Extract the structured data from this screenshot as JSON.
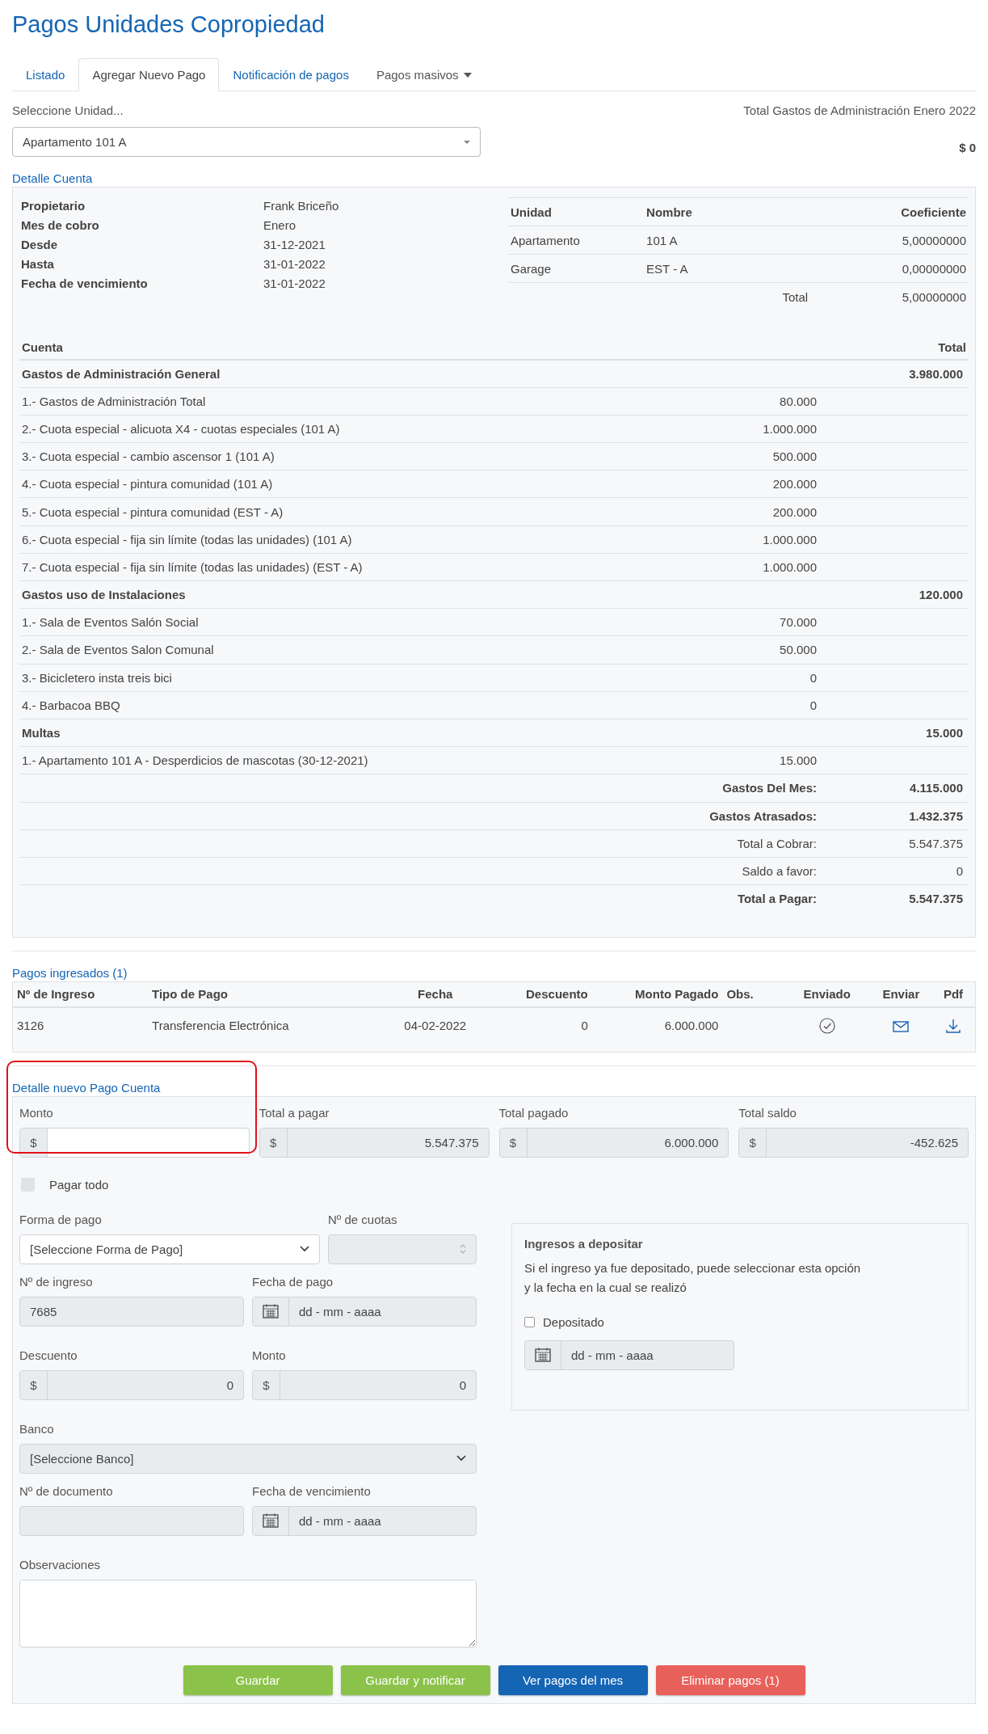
{
  "title": "Pagos Unidades Copropiedad",
  "tabs": [
    {
      "label": "Listado",
      "kind": "link",
      "selected": false
    },
    {
      "label": "Agregar Nuevo Pago",
      "kind": "link",
      "selected": true
    },
    {
      "label": "Notificación de pagos",
      "kind": "link",
      "selected": false
    },
    {
      "label": "Pagos masivos",
      "kind": "dropdown",
      "selected": false
    }
  ],
  "unit_select": {
    "label": "Seleccione Unidad...",
    "value": "Apartamento 101 A"
  },
  "admin_total": {
    "label": "Total Gastos de Administración Enero 2022",
    "value": "$ 0"
  },
  "account_detail": {
    "heading": "Detalle Cuenta",
    "info": [
      {
        "label": "Propietario",
        "value": "Frank Briceño"
      },
      {
        "label": "Mes de cobro",
        "value": "Enero"
      },
      {
        "label": "Desde",
        "value": "31-12-2021"
      },
      {
        "label": "Hasta",
        "value": "31-01-2022"
      },
      {
        "label": "Fecha de vencimiento",
        "value": "31-01-2022"
      }
    ],
    "units_table": {
      "columns": [
        "Unidad",
        "Nombre",
        "Coeficiente"
      ],
      "rows": [
        [
          "Apartamento",
          "101 A",
          "5,00000000"
        ],
        [
          "Garage",
          "EST - A",
          "0,00000000"
        ]
      ],
      "total_label": "Total",
      "total_value": "5,00000000"
    },
    "accounts": {
      "columns": [
        "Cuenta",
        "Total"
      ],
      "rows": [
        {
          "kind": "group",
          "label": "Gastos de Administración General",
          "total": "3.980.000"
        },
        {
          "kind": "item",
          "label": "1.- Gastos de Administración Total",
          "amount": "80.000"
        },
        {
          "kind": "item",
          "label": "2.- Cuota especial - alicuota X4 - cuotas especiales (101 A)",
          "amount": "1.000.000"
        },
        {
          "kind": "item",
          "label": "3.- Cuota especial - cambio ascensor 1 (101 A)",
          "amount": "500.000"
        },
        {
          "kind": "item",
          "label": "4.- Cuota especial - pintura comunidad (101 A)",
          "amount": "200.000"
        },
        {
          "kind": "item",
          "label": "5.- Cuota especial - pintura comunidad (EST - A)",
          "amount": "200.000"
        },
        {
          "kind": "item",
          "label": "6.- Cuota especial - fija sin límite (todas las unidades) (101 A)",
          "amount": "1.000.000"
        },
        {
          "kind": "item",
          "label": "7.- Cuota especial - fija sin límite (todas las unidades) (EST - A)",
          "amount": "1.000.000"
        },
        {
          "kind": "group",
          "label": "Gastos uso de Instalaciones",
          "total": "120.000"
        },
        {
          "kind": "item",
          "label": "1.- Sala de Eventos Salón Social",
          "amount": "70.000"
        },
        {
          "kind": "item",
          "label": "2.- Sala de Eventos Salon Comunal",
          "amount": "50.000"
        },
        {
          "kind": "item",
          "label": "3.- Bicicletero insta treis bici",
          "amount": "0"
        },
        {
          "kind": "item",
          "label": "4.- Barbacoa BBQ",
          "amount": "0"
        },
        {
          "kind": "group",
          "label": "Multas",
          "total": "15.000"
        },
        {
          "kind": "item",
          "label": "1.- Apartamento 101 A - Desperdicios de mascotas (30-12-2021)",
          "amount": "15.000"
        },
        {
          "kind": "summary",
          "label": "Gastos Del Mes:",
          "total": "4.115.000",
          "bold": true
        },
        {
          "kind": "summary",
          "label": "Gastos Atrasados:",
          "total": "1.432.375",
          "bold": true
        },
        {
          "kind": "summary",
          "label": "Total a Cobrar:",
          "total": "5.547.375",
          "bold": false
        },
        {
          "kind": "summary",
          "label": "Saldo a favor:",
          "total": "0",
          "bold": false
        },
        {
          "kind": "summary",
          "label": "Total a Pagar:",
          "total": "5.547.375",
          "bold": true
        }
      ]
    }
  },
  "payments": {
    "heading": "Pagos ingresados (1)",
    "columns": [
      "Nº de Ingreso",
      "Tipo de Pago",
      "Fecha",
      "Descuento",
      "Monto Pagado",
      "Obs.",
      "Enviado",
      "Enviar",
      "Pdf"
    ],
    "rows": [
      {
        "number": "3126",
        "type": "Transferencia Electrónica",
        "date": "04-02-2022",
        "discount": "0",
        "amount": "6.000.000",
        "sent": true
      }
    ]
  },
  "new_payment": {
    "heading": "Detalle nuevo Pago Cuenta",
    "highlight": true,
    "totals": [
      {
        "label": "Monto",
        "prefix": "$",
        "editable": true
      },
      {
        "label": "Total a pagar",
        "prefix": "$",
        "value": "5.547.375",
        "editable": false
      },
      {
        "label": "Total pagado",
        "prefix": "$",
        "value": "6.000.000",
        "editable": false
      },
      {
        "label": "Total saldo",
        "prefix": "$",
        "value": "-452.625",
        "editable": false
      }
    ],
    "pay_all": {
      "label": "Pagar todo",
      "checked": false
    },
    "payment_method": {
      "label": "Forma de pago",
      "value": "[Seleccione Forma de Pago]"
    },
    "installments": {
      "label": "Nº de cuotas"
    },
    "receipt_number": {
      "label": "Nº de ingreso",
      "value": "7685"
    },
    "payment_date": {
      "label": "Fecha de pago",
      "placeholder": "dd - mm - aaaa"
    },
    "discount": {
      "label": "Descuento",
      "prefix": "$",
      "value": "0"
    },
    "amount": {
      "label": "Monto",
      "prefix": "$",
      "value": "0"
    },
    "bank": {
      "label": "Banco",
      "value": "[Seleccione Banco]"
    },
    "document_number": {
      "label": "Nº de documento"
    },
    "due_date": {
      "label": "Fecha de vencimiento",
      "placeholder": "dd - mm - aaaa"
    },
    "notes": {
      "label": "Observaciones"
    },
    "deposit": {
      "title": "Ingresos a depositar",
      "lines": [
        "Si el ingreso ya fue depositado, puede seleccionar esta opción",
        "y la fecha en la cual se realizó"
      ],
      "checkbox": {
        "label": "Depositado",
        "checked": false
      },
      "date_placeholder": "dd - mm - aaaa"
    },
    "buttons": [
      {
        "label": "Guardar",
        "color": "#8bc34a"
      },
      {
        "label": "Guardar y notificar",
        "color": "#8bc34a"
      },
      {
        "label": "Ver pagos del mes",
        "color": "#1565b5"
      },
      {
        "label": "Eliminar pagos (1)",
        "color": "#e8605a"
      }
    ]
  }
}
